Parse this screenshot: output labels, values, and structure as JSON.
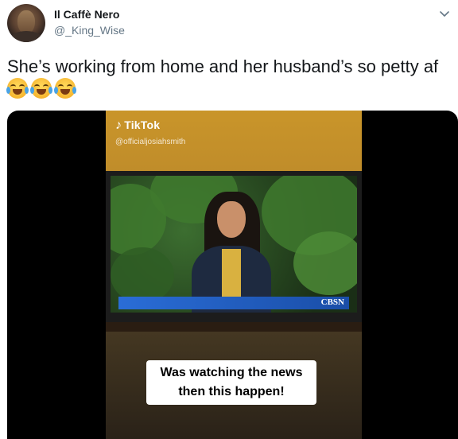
{
  "user": {
    "display_name": "Il Caffè Nero",
    "handle": "@_King_Wise",
    "avatar_icon": "user-avatar"
  },
  "menu": {
    "icon": "chevron-down-icon"
  },
  "tweet": {
    "text": "She’s working from home and her husband’s so petty af",
    "emojis": [
      "face-with-tears-of-joy",
      "face-with-tears-of-joy",
      "face-with-tears-of-joy"
    ]
  },
  "media": {
    "watermark": "TikTok",
    "watermark_user": "@officialjosiahsmith",
    "tv_channel": "CBSN",
    "caption_line1": "Was watching the news",
    "caption_line2": "then this happen!"
  },
  "colors": {
    "accent": "#1da1f2",
    "text_primary": "#14171a",
    "text_secondary": "#657786"
  }
}
